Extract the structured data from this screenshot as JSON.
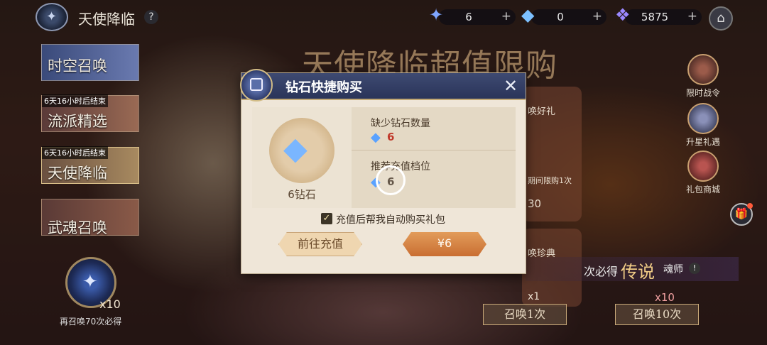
{
  "topbar": {
    "title": "天使降临",
    "help_icon": "?",
    "resources": [
      {
        "icon": "star-crystal-icon",
        "value": "6"
      },
      {
        "icon": "diamond-icon",
        "value": "0"
      },
      {
        "icon": "soul-crystal-icon",
        "value": "5875"
      }
    ]
  },
  "left_menu": [
    {
      "label": "时空召唤",
      "tag": ""
    },
    {
      "label": "流派精选",
      "tag": "6天16小时后结束"
    },
    {
      "label": "天使降临",
      "tag": "6天16小时后结束"
    },
    {
      "label": "武魂召唤",
      "tag": ""
    }
  ],
  "summon": {
    "x10": "x10",
    "pity_text": "再召唤70次必得"
  },
  "banner": {
    "title": "天使降临超值限购"
  },
  "right_side": [
    {
      "label": "限时战令"
    },
    {
      "label": "升星礼遇"
    },
    {
      "label": "礼包商城"
    }
  ],
  "right_cards": {
    "card1_title": "唤好礼",
    "card1_limit": "期间限购1次",
    "card1_price": "30",
    "card2_title": "唤珍典",
    "card2_count": "x1"
  },
  "legend": {
    "prefix": "次必得",
    "big": "传说",
    "suffix": "魂师",
    "info": "!"
  },
  "bottom": {
    "x10_count": "x10",
    "summon_once": "召唤1次",
    "summon_ten": "召唤10次"
  },
  "modal": {
    "title": "钻石快捷购买",
    "gem_label": "6钻石",
    "missing_label": "缺少钻石数量",
    "missing_value": "6",
    "recommend_label": "推荐充值档位",
    "recommend_value": "6",
    "auto_buy_label": "充值后帮我自动购买礼包",
    "auto_buy_checked": true,
    "recharge_button": "前往充值",
    "buy_button": "¥6",
    "missing_value_color": "#c0392b",
    "buy_button_color": "#d07a3a"
  }
}
